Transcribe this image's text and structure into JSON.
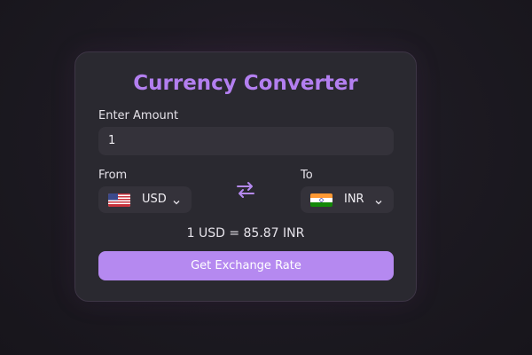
{
  "title": "Currency Converter",
  "amount": {
    "label": "Enter Amount",
    "value": "1"
  },
  "from": {
    "label": "From",
    "currency": "USD",
    "flag_icon": "us-flag-icon"
  },
  "to": {
    "label": "To",
    "currency": "INR",
    "flag_icon": "india-flag-icon"
  },
  "swap_icon": "swap-arrows-icon",
  "rate_text": "1 USD = 85.87 INR",
  "button_label": "Get Exchange Rate",
  "colors": {
    "accent": "#b589f0",
    "title": "#b37ff0",
    "card": "#2a2930",
    "field": "#34323a"
  }
}
